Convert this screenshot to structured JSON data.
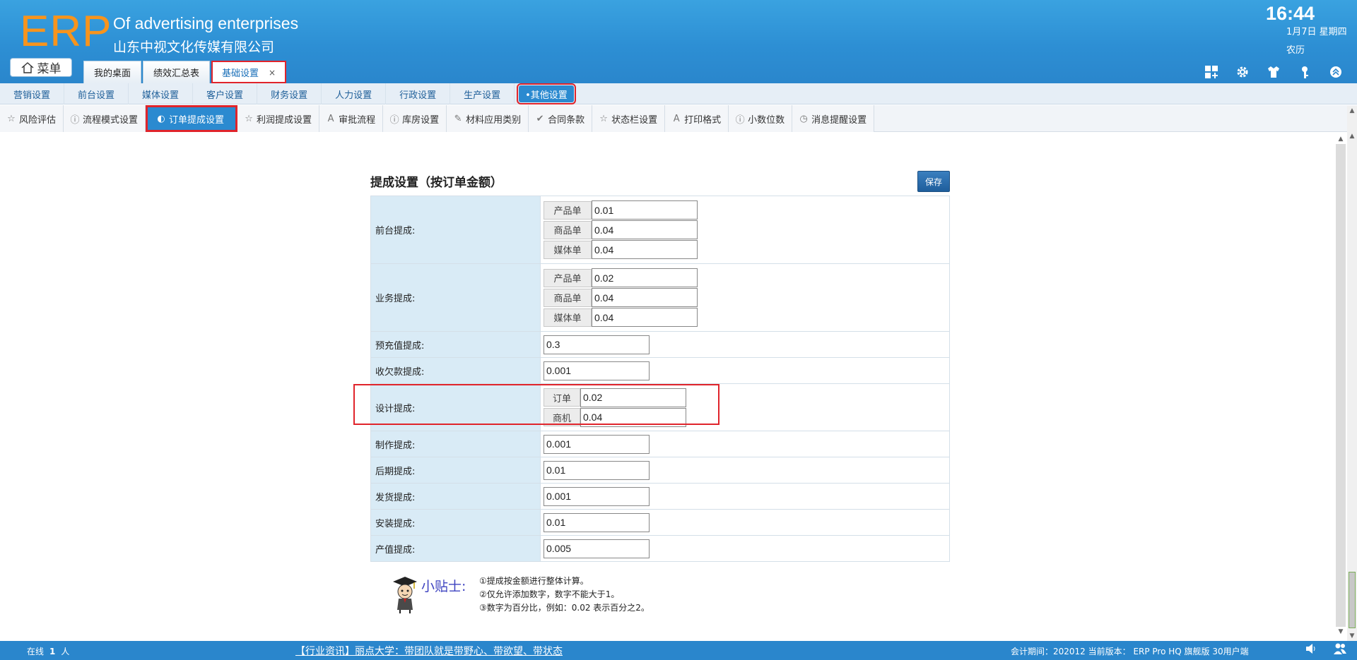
{
  "brand": {
    "logo": "ERP",
    "english": "Of advertising enterprises",
    "company": "山东中视文化传媒有限公司"
  },
  "clock": {
    "time": "16:44",
    "date": "1月7日 星期四",
    "lunar": "农历"
  },
  "menu_label": "菜单",
  "tabs": [
    {
      "label": "我的桌面"
    },
    {
      "label": "绩效汇总表"
    },
    {
      "label": "基础设置",
      "close": "×"
    }
  ],
  "header_icons": [
    "apps-icon",
    "gear-icon",
    "shirt-icon",
    "key-icon",
    "collapse-icon"
  ],
  "nav1": [
    {
      "label": "营销设置"
    },
    {
      "label": "前台设置"
    },
    {
      "label": "媒体设置"
    },
    {
      "label": "客户设置"
    },
    {
      "label": "财务设置"
    },
    {
      "label": "人力设置"
    },
    {
      "label": "行政设置"
    },
    {
      "label": "生产设置"
    },
    {
      "label": "•其他设置"
    }
  ],
  "nav2": [
    {
      "label": "风险评估",
      "icon": "☆"
    },
    {
      "label": "流程模式设置",
      "icon": "ⓘ"
    },
    {
      "label": "订单提成设置",
      "icon": "◐"
    },
    {
      "label": "利润提成设置",
      "icon": "☆"
    },
    {
      "label": "审批流程",
      "icon": "A"
    },
    {
      "label": "库房设置",
      "icon": "ⓘ"
    },
    {
      "label": "材料应用类别",
      "icon": "✎"
    },
    {
      "label": "合同条款",
      "icon": "✔"
    },
    {
      "label": "状态栏设置",
      "icon": "☆"
    },
    {
      "label": "打印格式",
      "icon": "A"
    },
    {
      "label": "小数位数",
      "icon": "ⓘ"
    },
    {
      "label": "消息提醒设置",
      "icon": "◷"
    }
  ],
  "panel": {
    "title": "提成设置（按订单金额）",
    "save": "保存",
    "rows": {
      "front": {
        "label": "前台提成:",
        "subs": [
          {
            "tag": "产品单",
            "value": "0.01"
          },
          {
            "tag": "商品单",
            "value": "0.04"
          },
          {
            "tag": "媒体单",
            "value": "0.04"
          }
        ]
      },
      "business": {
        "label": "业务提成:",
        "subs": [
          {
            "tag": "产品单",
            "value": "0.02"
          },
          {
            "tag": "商品单",
            "value": "0.04"
          },
          {
            "tag": "媒体单",
            "value": "0.04"
          }
        ]
      },
      "prepaid": {
        "label": "预充值提成:",
        "value": "0.3"
      },
      "arrears": {
        "label": "收欠款提成:",
        "value": "0.001"
      },
      "design": {
        "label": "设计提成:",
        "subs": [
          {
            "tag": "订单",
            "value": "0.02"
          },
          {
            "tag": "商机",
            "value": "0.04"
          }
        ]
      },
      "produce": {
        "label": "制作提成:",
        "value": "0.001"
      },
      "later": {
        "label": "后期提成:",
        "value": "0.01"
      },
      "ship": {
        "label": "发货提成:",
        "value": "0.001"
      },
      "install": {
        "label": "安装提成:",
        "value": "0.01"
      },
      "output": {
        "label": "产值提成:",
        "value": "0.005"
      }
    }
  },
  "tips": {
    "title": "小贴士:",
    "lines": [
      "①提成按金额进行整体计算。",
      "②仅允许添加数字，数字不能大于1。",
      "③数字为百分比，例如：0.02 表示百分之2。"
    ]
  },
  "footer": {
    "online_label": "在线",
    "online_count": "1",
    "online_unit": "人",
    "news": "【行业资讯】丽点大学：带团队就是带野心、带欲望、带状态",
    "period": "会计期间：202012 当前版本： ERP Pro HQ 旗舰版 30用户端"
  },
  "colors": {
    "header": "#2d8fd4",
    "accent": "#f7941d",
    "highlight": "#e0242b",
    "label_bg": "#d9ebf6"
  }
}
